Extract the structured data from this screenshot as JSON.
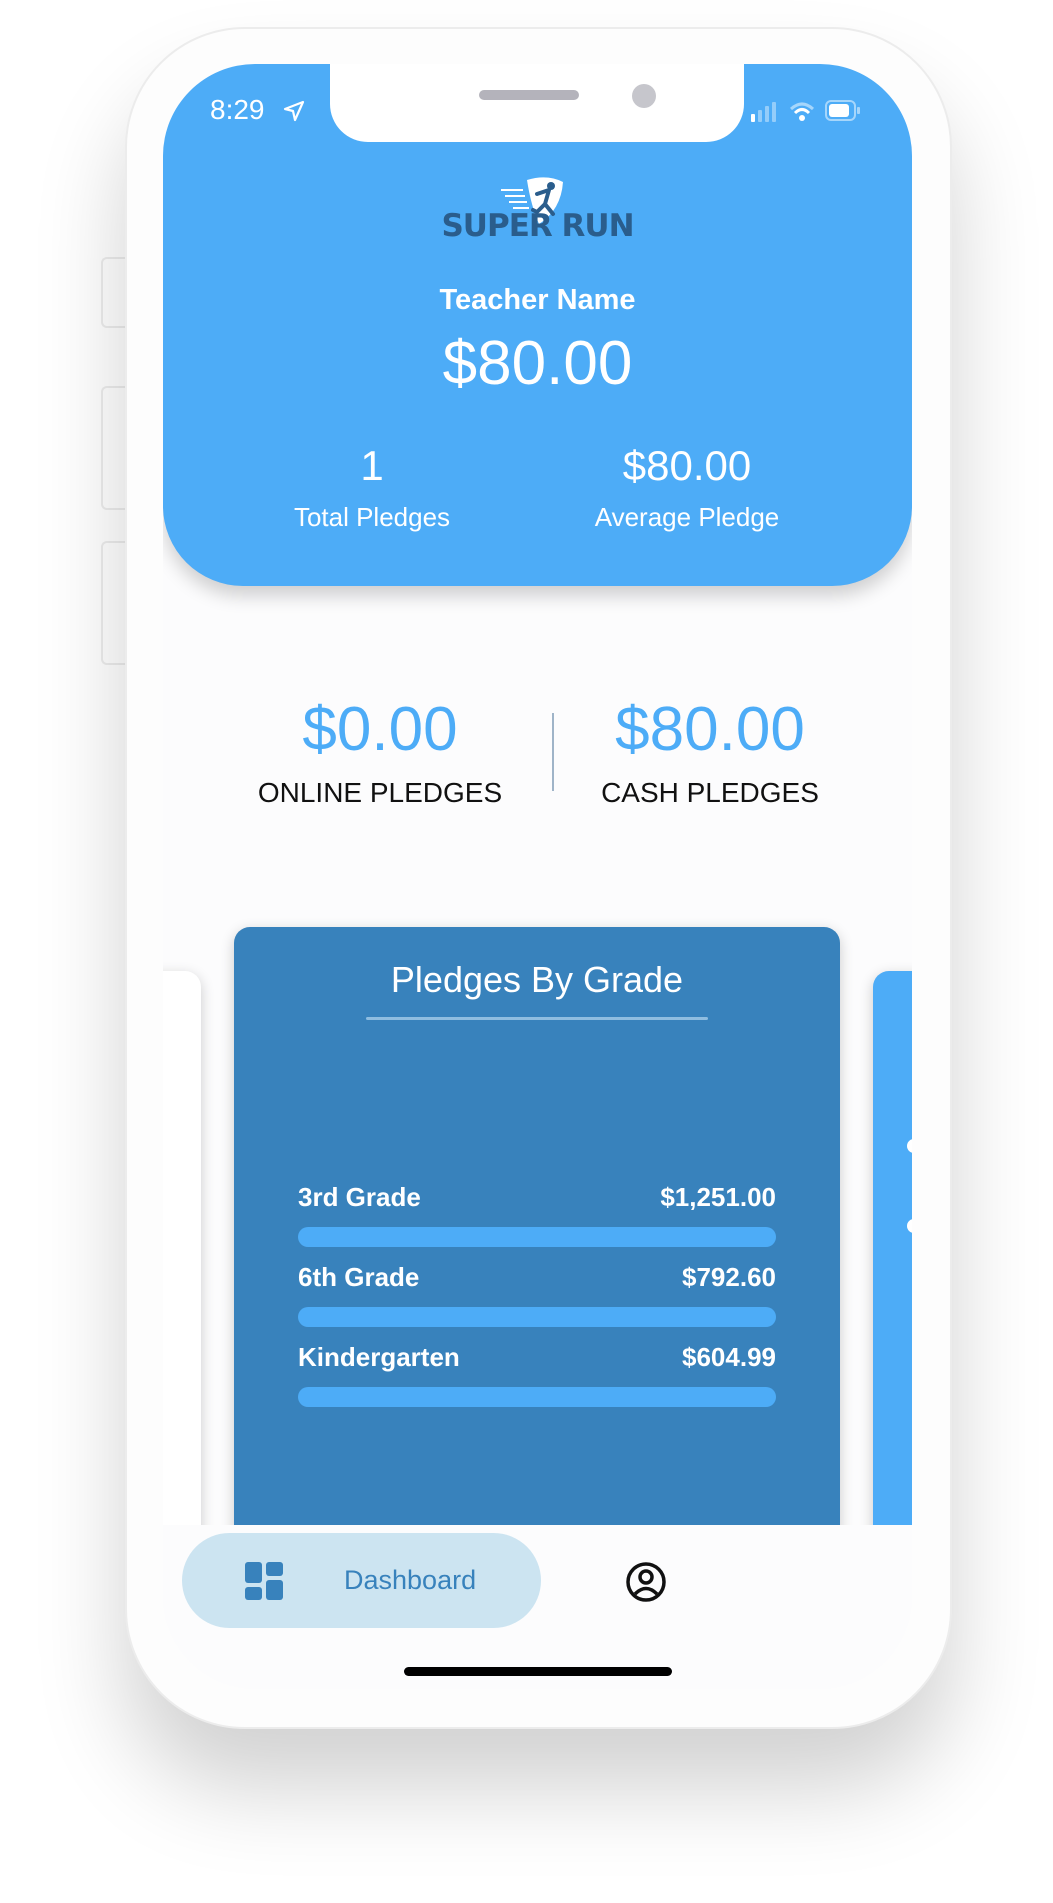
{
  "status_bar": {
    "time": "8:29"
  },
  "header": {
    "logo_text": "SUPER RUN",
    "teacher_name": "Teacher Name",
    "total_amount": "$80.00",
    "stats": [
      {
        "value": "1",
        "label": "Total Pledges"
      },
      {
        "value": "$80.00",
        "label": "Average Pledge"
      }
    ]
  },
  "summary": {
    "online": {
      "value": "$0.00",
      "label": "ONLINE PLEDGES"
    },
    "cash": {
      "value": "$80.00",
      "label": "CASH PLEDGES"
    }
  },
  "grade_card": {
    "title": "Pledges By Grade",
    "rows": [
      {
        "label": "3rd Grade",
        "amount": "$1,251.00",
        "progress": 1.0
      },
      {
        "label": "6th Grade",
        "amount": "$792.60",
        "progress": 1.0
      },
      {
        "label": "Kindergarten",
        "amount": "$604.99",
        "progress": 1.0
      }
    ]
  },
  "nav": {
    "dashboard_label": "Dashboard"
  },
  "colors": {
    "primary": "#4dacf7",
    "card": "#3882bc",
    "pill": "#cce4f1"
  }
}
